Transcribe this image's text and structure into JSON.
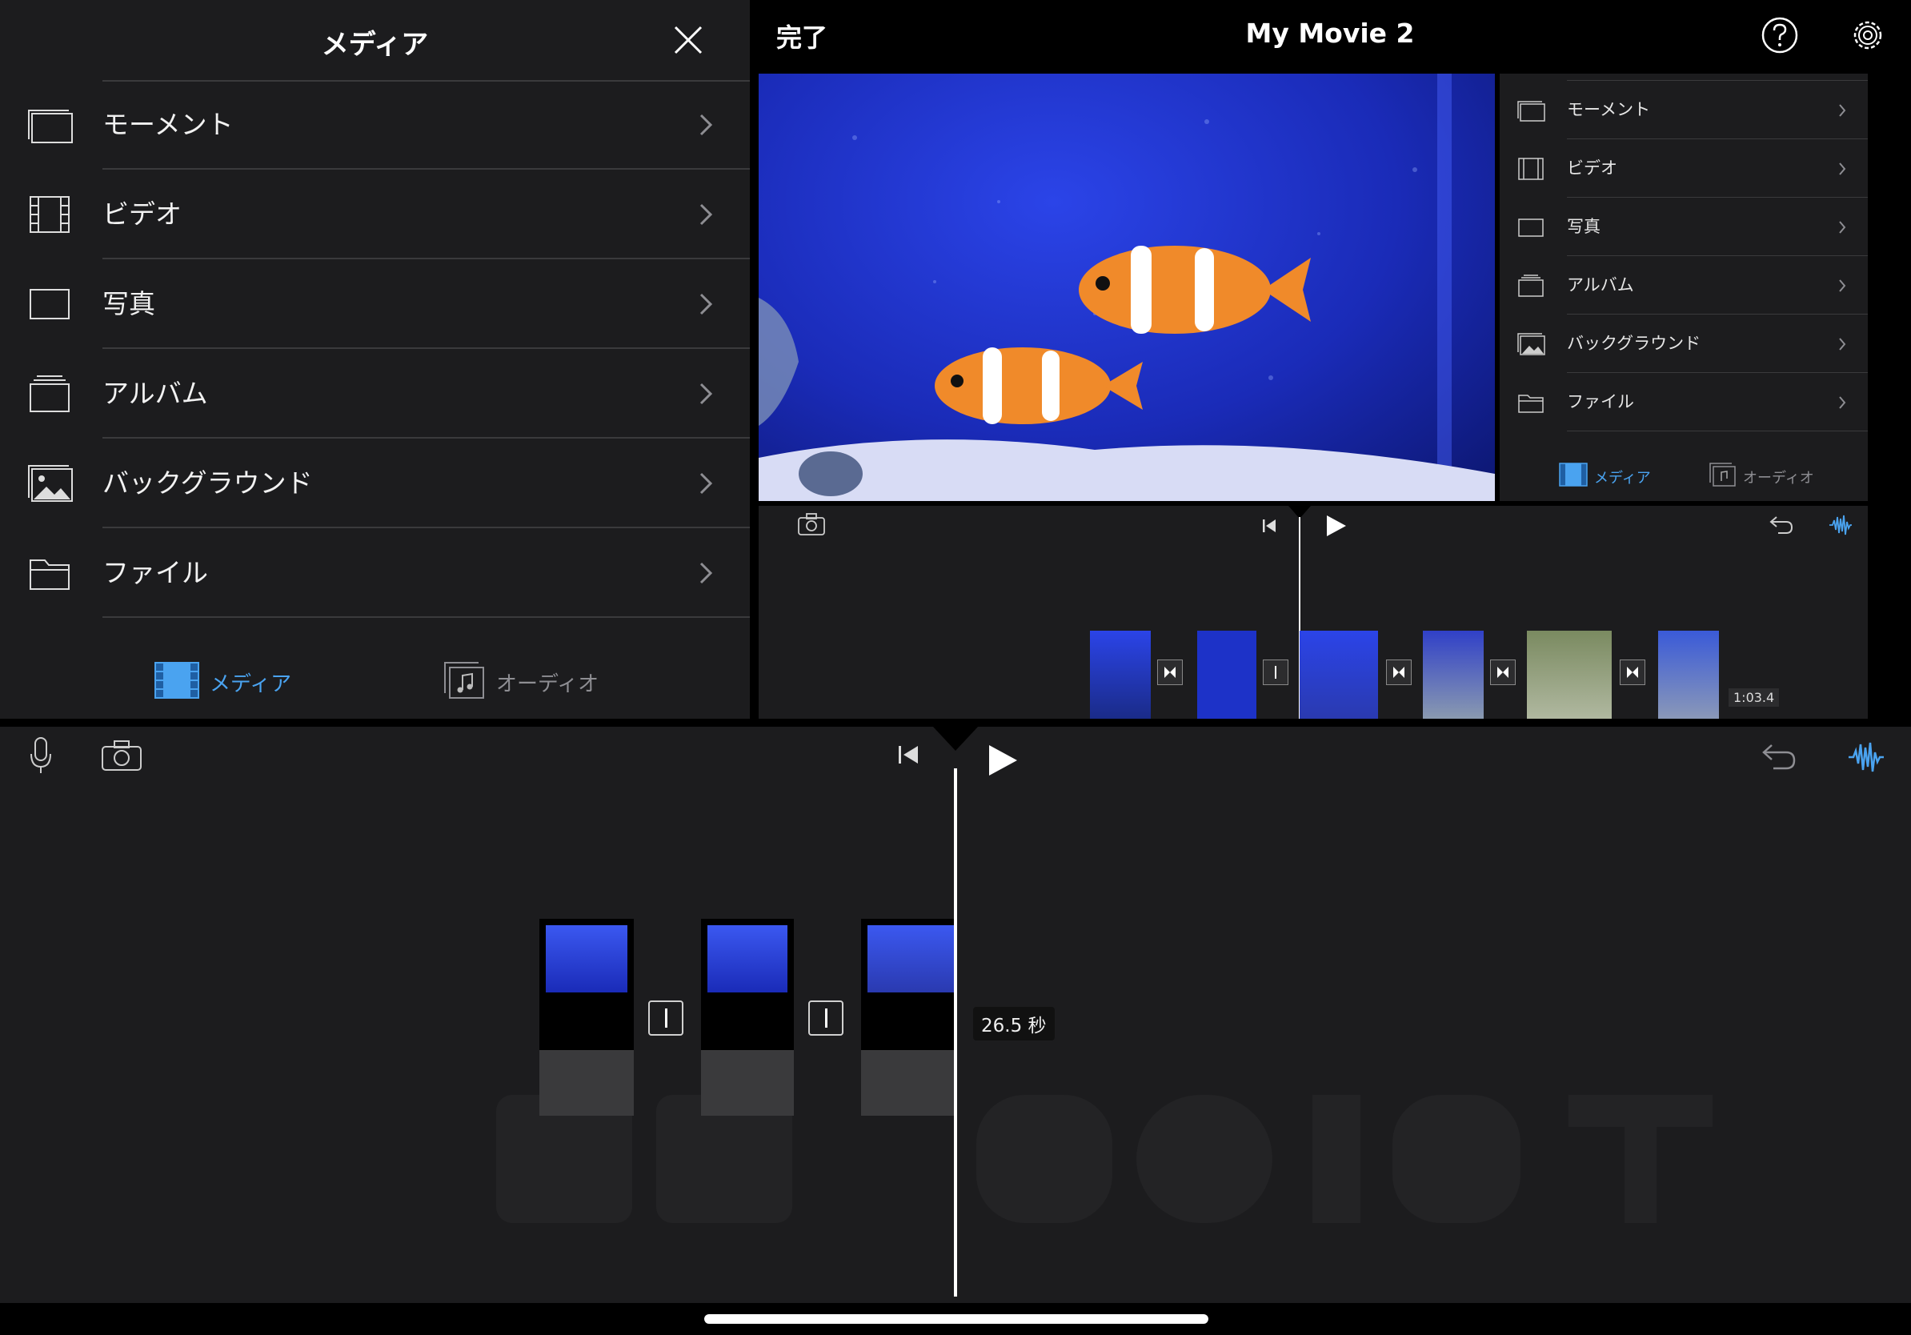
{
  "left_panel": {
    "title": "メディア",
    "items": [
      {
        "label": "モーメント",
        "icon": "moments-icon"
      },
      {
        "label": "ビデオ",
        "icon": "film-icon"
      },
      {
        "label": "写真",
        "icon": "photo-frame-icon"
      },
      {
        "label": "アルバム",
        "icon": "album-stack-icon"
      },
      {
        "label": "バックグラウンド",
        "icon": "background-image-icon"
      },
      {
        "label": "ファイル",
        "icon": "folder-icon"
      }
    ],
    "tabs": [
      {
        "label": "メディア",
        "active": true
      },
      {
        "label": "オーディオ",
        "active": false
      }
    ]
  },
  "header": {
    "done_label": "完了",
    "title": "My Movie 2"
  },
  "right_panel": {
    "items": [
      {
        "label": "モーメント"
      },
      {
        "label": "ビデオ"
      },
      {
        "label": "写真"
      },
      {
        "label": "アルバム"
      },
      {
        "label": "バックグラウンド"
      },
      {
        "label": "ファイル"
      }
    ],
    "tabs": [
      {
        "label": "メディア",
        "active": true
      },
      {
        "label": "オーディオ",
        "active": false
      }
    ]
  },
  "mini_timeline": {
    "duration": "1:03.4"
  },
  "main_timeline": {
    "playhead_time": "26.5 秒"
  },
  "colors": {
    "accent": "#4aa3f0",
    "panel_bg": "#1c1c1e",
    "separator": "#3a3a3c"
  }
}
